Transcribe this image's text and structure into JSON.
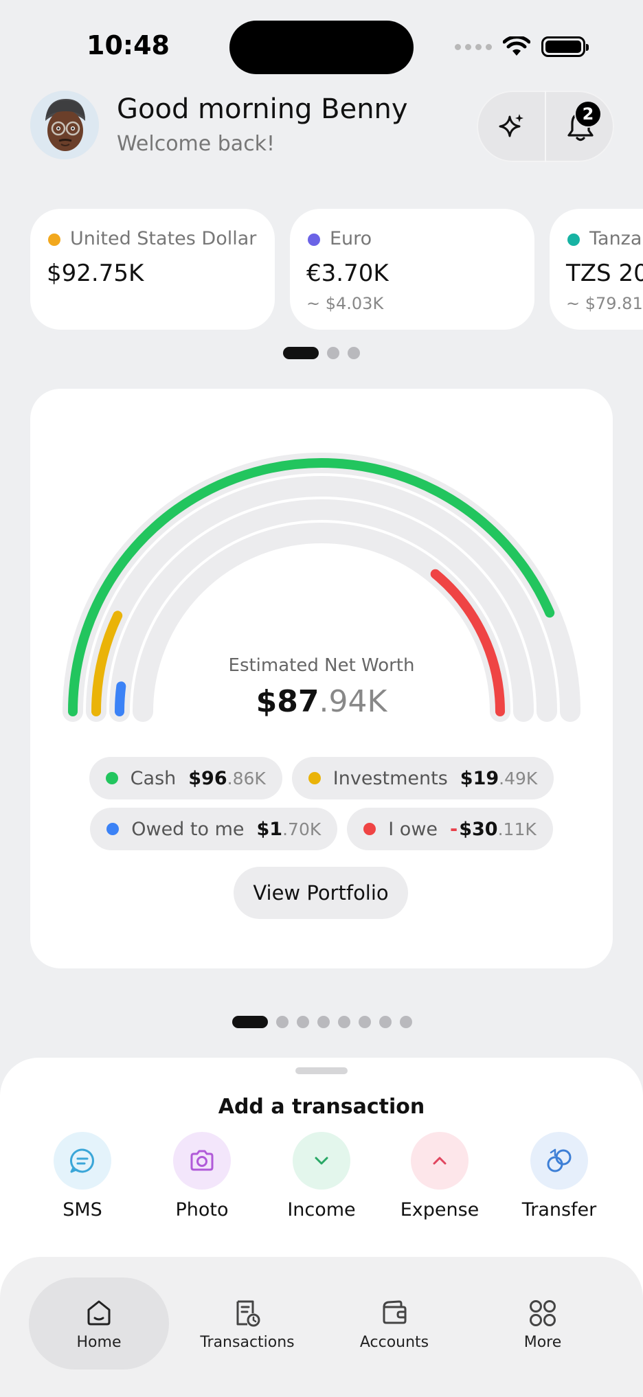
{
  "status_bar": {
    "time": "10:48"
  },
  "header": {
    "greeting": "Good morning Benny",
    "subtitle": "Welcome back!",
    "notification_count": "2"
  },
  "currencies": [
    {
      "name": "United States Dollar",
      "amount": "$92.75K",
      "approx": "",
      "color": "#f2a81d"
    },
    {
      "name": "Euro",
      "amount": "€3.70K",
      "approx": "~ $4.03K",
      "color": "#6b63e6"
    },
    {
      "name": "Tanza",
      "amount": "TZS 20",
      "approx": "~ $79.81",
      "color": "#17b3a3"
    }
  ],
  "currency_pager": {
    "pages": 3,
    "active": 0
  },
  "net_worth": {
    "label": "Estimated Net Worth",
    "value_int": "$87",
    "value_dec": ".94K",
    "gauge_levels": {
      "cash": 0.87,
      "investments": 0.14,
      "owed_to_me": 0.04,
      "i_owe": 0.28
    },
    "legend": [
      {
        "label": "Cash",
        "int": "$96",
        "dec": ".86K",
        "neg": "",
        "color": "#22c55e"
      },
      {
        "label": "Investments",
        "int": "$19",
        "dec": ".49K",
        "neg": "",
        "color": "#eab308"
      },
      {
        "label": "Owed to me",
        "int": "$1",
        "dec": ".70K",
        "neg": "",
        "color": "#3b82f6"
      },
      {
        "label": "I owe",
        "int": "$30",
        "dec": ".11K",
        "neg": "-",
        "color": "#ef4444"
      }
    ],
    "button": "View Portfolio"
  },
  "cards_pager": {
    "pages": 8,
    "active": 0
  },
  "add_transaction": {
    "title": "Add a transaction",
    "actions": [
      {
        "label": "SMS",
        "icon": "sms-icon",
        "bg": "#e4f3fb",
        "fg": "#3aa6d8"
      },
      {
        "label": "Photo",
        "icon": "camera-icon",
        "bg": "#f3e6fb",
        "fg": "#b05ad8"
      },
      {
        "label": "Income",
        "icon": "chevron-down-icon",
        "bg": "#e3f6ec",
        "fg": "#2aa866"
      },
      {
        "label": "Expense",
        "icon": "chevron-up-icon",
        "bg": "#fde6ea",
        "fg": "#e0465f"
      },
      {
        "label": "Transfer",
        "icon": "transfer-icon",
        "bg": "#e6effb",
        "fg": "#3d7fd6"
      }
    ]
  },
  "tabs": [
    {
      "label": "Home",
      "icon": "home-icon",
      "active": true
    },
    {
      "label": "Transactions",
      "icon": "receipt-icon",
      "active": false
    },
    {
      "label": "Accounts",
      "icon": "wallet-icon",
      "active": false
    },
    {
      "label": "More",
      "icon": "grid-icon",
      "active": false
    }
  ]
}
